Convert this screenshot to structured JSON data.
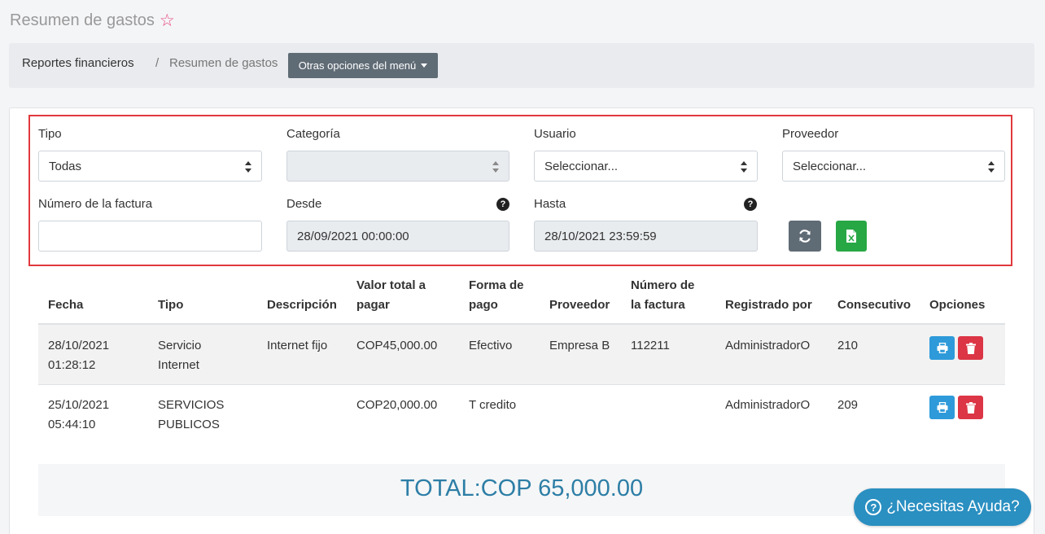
{
  "page": {
    "title": "Resumen de gastos"
  },
  "breadcrumb": {
    "item1": "Reportes financieros",
    "separator": "/",
    "item2": "Resumen de gastos"
  },
  "menu_button": {
    "label": "Otras opciones del menú"
  },
  "filters": {
    "tipo": {
      "label": "Tipo",
      "value": "Todas"
    },
    "categoria": {
      "label": "Categoría",
      "value": ""
    },
    "usuario": {
      "label": "Usuario",
      "value": "Seleccionar..."
    },
    "proveedor": {
      "label": "Proveedor",
      "value": "Seleccionar..."
    },
    "numero_factura": {
      "label": "Número de la factura",
      "value": ""
    },
    "desde": {
      "label": "Desde",
      "value": "28/09/2021 00:00:00"
    },
    "hasta": {
      "label": "Hasta",
      "value": "28/10/2021 23:59:59"
    }
  },
  "table": {
    "headers": {
      "fecha": "Fecha",
      "tipo": "Tipo",
      "descripcion": "Descripción",
      "valor_1": "Valor total a",
      "valor_2": "pagar",
      "forma_1": "Forma de",
      "forma_2": "pago",
      "proveedor": "Proveedor",
      "numero_1": "Número de",
      "numero_2": "la factura",
      "registrado": "Registrado por",
      "consecutivo": "Consecutivo",
      "opciones": "Opciones"
    },
    "rows": [
      {
        "fecha_1": "28/10/2021",
        "fecha_2": "01:28:12",
        "tipo_1": "Servicio",
        "tipo_2": "Internet",
        "descripcion": "Internet fijo",
        "valor": "COP45,000.00",
        "forma": "Efectivo",
        "proveedor": "Empresa B",
        "numero": "112211",
        "registrado": "AdministradorO",
        "consecutivo": "210"
      },
      {
        "fecha_1": "25/10/2021",
        "fecha_2": "05:44:10",
        "tipo_1": "SERVICIOS",
        "tipo_2": "PUBLICOS",
        "descripcion": "",
        "valor": "COP20,000.00",
        "forma": "T credito",
        "proveedor": "",
        "numero": "",
        "registrado": "AdministradorO",
        "consecutivo": "209"
      }
    ]
  },
  "total": {
    "text": "TOTAL:COP 65,000.00"
  },
  "help": {
    "label": "¿Necesitas Ayuda?"
  },
  "icons": {
    "star": "star-icon",
    "refresh": "refresh-icon",
    "excel": "excel-icon",
    "print": "print-icon",
    "trash": "trash-icon",
    "question": "question-circle-icon"
  },
  "colors": {
    "accent_blue": "#2e9ad9",
    "danger": "#dc3545",
    "excel_green": "#28a745",
    "refresh_grey": "#5f6b75",
    "filter_border": "#e0393e",
    "total_text": "#2d7ea6"
  }
}
